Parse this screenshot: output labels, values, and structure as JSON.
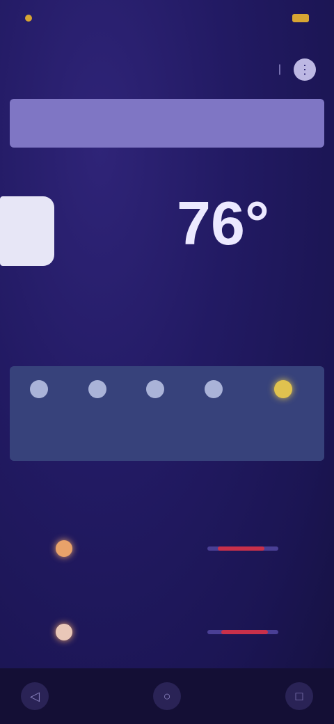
{
  "status": {
    "time": "",
    "carrier": "",
    "battery": ""
  },
  "header": {
    "location": "",
    "menu_icon": "more-icon"
  },
  "current": {
    "city": "",
    "subtitle": "",
    "temperature": "76°",
    "left_label": "",
    "right_label": ""
  },
  "forecast": {
    "title": "",
    "hours": [
      {
        "time": "",
        "icon": "moon-icon"
      },
      {
        "time": "",
        "icon": "moon-icon"
      },
      {
        "time": "",
        "icon": "moon-icon"
      },
      {
        "time": "",
        "icon": "moon-icon"
      },
      {
        "time": "",
        "icon": "sun-icon"
      }
    ]
  },
  "daily": {
    "section1": "",
    "day1": {
      "name": "",
      "condition": "",
      "low": "",
      "high": ""
    },
    "section2": "",
    "day2": {
      "name": "",
      "condition": "",
      "low": "",
      "high": ""
    }
  },
  "colors": {
    "accent": "#d7a533",
    "bar": "#c9304a"
  }
}
